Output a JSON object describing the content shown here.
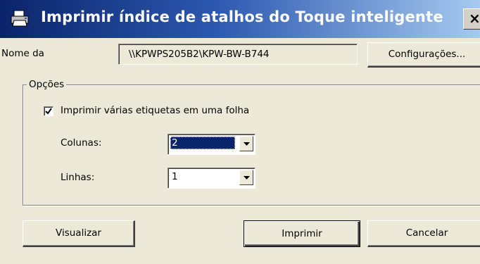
{
  "window": {
    "title": "Imprimir índice de atalhos do Toque inteligente",
    "close_glyph": "×",
    "icon": "printer-icon"
  },
  "printer": {
    "label": "Nome da",
    "value": "\\\\KPWPS205B2\\KPW-BW-B744",
    "settings_button": "Configurações..."
  },
  "options": {
    "group_label": "Opções",
    "multi_label_checkbox": {
      "label": "Imprimir várias etiquetas em uma folha",
      "checked": true
    },
    "columns": {
      "label": "Colunas:",
      "value": "2"
    },
    "rows": {
      "label": "Linhas:",
      "value": "1"
    }
  },
  "buttons": {
    "preview": "Visualizar",
    "print": "Imprimir",
    "cancel": "Cancelar"
  },
  "colors": {
    "titlebar_start": "#0a246a",
    "titlebar_end": "#a6caf0",
    "face": "#ece9d8",
    "selection": "#0a246a"
  }
}
